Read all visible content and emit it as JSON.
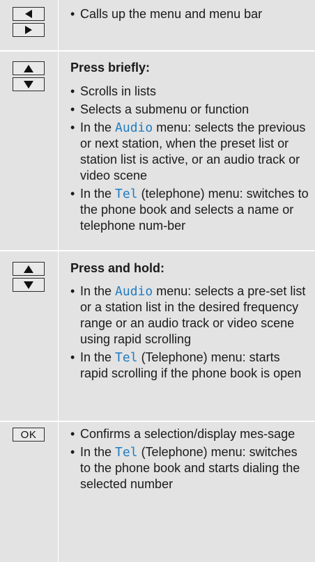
{
  "colors": {
    "row_bg": "#e3e3e3",
    "key_bg": "#e9e9e9",
    "menu_word": "#1f7cc1"
  },
  "rows": [
    {
      "keys": [
        "left-arrow-icon",
        "right-arrow-icon"
      ],
      "items": [
        {
          "text": "Calls up the menu and menu bar"
        }
      ]
    },
    {
      "keys": [
        "up-arrow-icon",
        "down-arrow-icon"
      ],
      "heading": "Press briefly:",
      "items": [
        {
          "text": "Scrolls in lists"
        },
        {
          "text": "Selects a submenu or function"
        },
        {
          "pre": "In the ",
          "menu": "Audio",
          "post": " menu: selects the previous or next station, when the preset list or station list is active, or an audio track or video scene"
        },
        {
          "pre": "In the ",
          "menu": "Tel",
          "post": " (telephone) menu: switches to the phone book and selects a name or telephone num-ber"
        }
      ]
    },
    {
      "keys": [
        "up-arrow-icon",
        "down-arrow-icon"
      ],
      "heading": "Press and hold:",
      "items": [
        {
          "pre": "In the ",
          "menu": "Audio",
          "post": " menu: selects a pre-set list or a station list in the desired frequency range or an audio track or video scene using rapid scrolling"
        },
        {
          "pre": "In the ",
          "menu": "Tel",
          "post": " (Telephone) menu: starts rapid scrolling if the phone book is open"
        }
      ]
    },
    {
      "key_label": "OK",
      "items": [
        {
          "text": "Confirms a selection/display mes-sage"
        },
        {
          "pre": "In the ",
          "menu": "Tel",
          "post": " (Telephone) menu: switches to the phone book and starts dialing the selected number"
        }
      ]
    }
  ]
}
